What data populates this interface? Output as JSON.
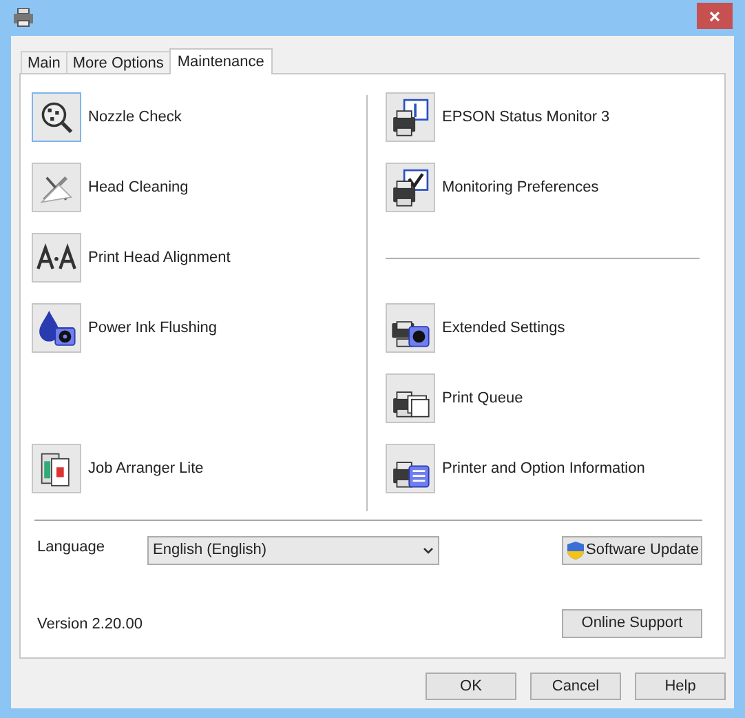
{
  "tabs": [
    {
      "label": "Main",
      "selected": false
    },
    {
      "label": "More Options",
      "selected": false
    },
    {
      "label": "Maintenance",
      "selected": true
    }
  ],
  "left_tools": [
    {
      "label": "Nozzle Check",
      "focused": true
    },
    {
      "label": "Head Cleaning",
      "focused": false
    },
    {
      "label": "Print Head Alignment",
      "focused": false
    },
    {
      "label": "Power Ink Flushing",
      "focused": false
    },
    {
      "label": "Job Arranger Lite",
      "focused": false
    }
  ],
  "right_tools": [
    {
      "label": "EPSON Status Monitor 3",
      "focused": false
    },
    {
      "label": "Monitoring Preferences",
      "focused": false
    },
    {
      "label": "Extended Settings",
      "focused": false
    },
    {
      "label": "Print Queue",
      "focused": false
    },
    {
      "label": "Printer and Option Information",
      "focused": false
    }
  ],
  "language": {
    "label": "Language",
    "value": "English (English)"
  },
  "software_update": "Software Update",
  "version": "Version 2.20.00",
  "online_support": "Online Support",
  "buttons": [
    "OK",
    "Cancel",
    "Help"
  ]
}
